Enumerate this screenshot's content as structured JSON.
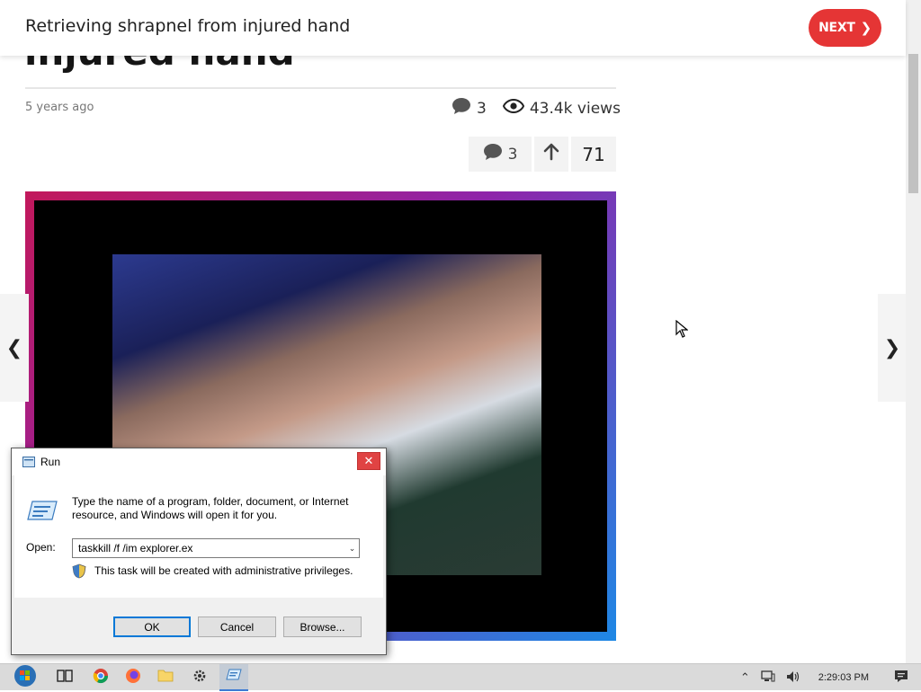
{
  "header": {
    "title": "Retrieving shrapnel from injured hand",
    "next_label": "NEXT"
  },
  "article": {
    "title_fragment": "injured hand",
    "age": "5 years ago",
    "comments_count": "3",
    "views": "43.4k views",
    "action_comments": "3",
    "score": "71"
  },
  "run_dialog": {
    "title": "Run",
    "description": "Type the name of a program, folder, document, or Internet resource, and Windows will open it for you.",
    "open_label": "Open:",
    "input_value": "taskkill /f /im explorer.ex",
    "admin_note": "This task will be created with administrative privileges.",
    "ok_label": "OK",
    "cancel_label": "Cancel",
    "browse_label": "Browse..."
  },
  "taskbar": {
    "clock": "2:29:03 PM",
    "apps": [
      "start",
      "task-view",
      "chrome",
      "firefox",
      "file-explorer",
      "settings",
      "run"
    ]
  },
  "colors": {
    "accent": "#e53535",
    "dialog_focus": "#0078d7"
  }
}
